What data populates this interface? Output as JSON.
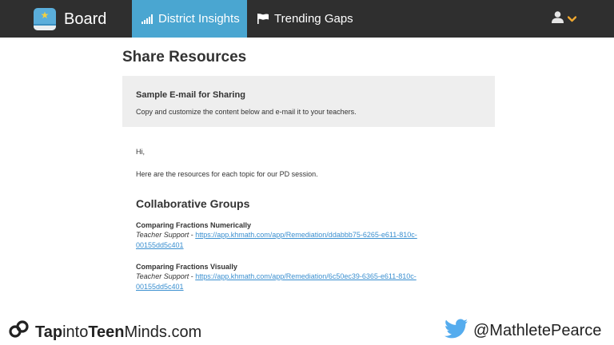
{
  "colors": {
    "topbar": "#2f2f2f",
    "active_tab": "#4aa6d1",
    "info_box": "#eeeeee",
    "link": "#3a8fd0",
    "chevron": "#f0a830",
    "twitter": "#55acee"
  },
  "nav": {
    "brand": "Board",
    "tabs": [
      {
        "label": "District Insights",
        "icon": "bar-chart-icon",
        "active": true
      },
      {
        "label": "Trending Gaps",
        "icon": "flag-icon",
        "active": false
      }
    ],
    "user_icon": "user-icon",
    "menu_icon": "chevron-down-icon"
  },
  "page": {
    "title": "Share Resources",
    "info": {
      "title": "Sample E-mail for Sharing",
      "text": "Copy and customize the content below and e-mail it to your teachers."
    },
    "email": {
      "greeting": "Hi,",
      "intro": "Here are the resources for each topic for our PD session.",
      "section_title": "Collaborative Groups",
      "topics": [
        {
          "title": "Comparing Fractions Numerically",
          "label": "Teacher Support",
          "separator": " - ",
          "url_line1": "https://app.khmath.com/app/Remediation/ddabbb75-6265-e611-810c-",
          "url_line2": "00155dd5c401"
        },
        {
          "title": "Comparing Fractions Visually",
          "label": "Teacher Support",
          "separator": " - ",
          "url_line1": "https://app.khmath.com/app/Remediation/6c50ec39-6365-e611-810c-",
          "url_line2": "00155dd5c401"
        }
      ]
    }
  },
  "watermark": {
    "left_part1": "Tap",
    "left_part2": "into",
    "left_part3": "Teen",
    "left_part4": "Minds.com",
    "right": "@MathletePearce"
  }
}
